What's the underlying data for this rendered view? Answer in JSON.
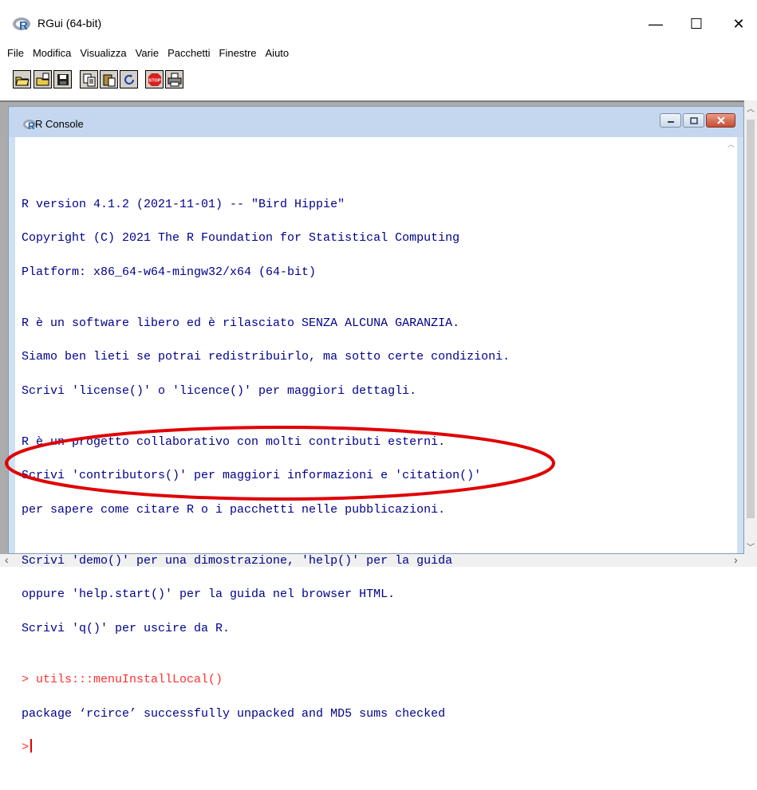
{
  "window": {
    "title": "RGui (64-bit)",
    "app_icon": "R",
    "minimize": "—",
    "maximize": "☐",
    "close": "✕"
  },
  "menu": [
    "File",
    "Modifica",
    "Visualizza",
    "Varie",
    "Pacchetti",
    "Finestre",
    "Aiuto"
  ],
  "toolbar": [
    {
      "icon": "open-folder-icon"
    },
    {
      "icon": "load-workspace-icon"
    },
    {
      "icon": "save-icon"
    },
    {
      "icon": "copy-icon"
    },
    {
      "icon": "paste-icon"
    },
    {
      "icon": "refresh-icon"
    },
    {
      "icon": "stop-icon",
      "label": "STOP"
    },
    {
      "icon": "print-icon"
    }
  ],
  "console": {
    "title": "R Console",
    "icon": "R",
    "lines": [
      {
        "text": "",
        "color": "blue"
      },
      {
        "text": "R version 4.1.2 (2021-11-01) -- \"Bird Hippie\"",
        "color": "blue"
      },
      {
        "text": "Copyright (C) 2021 The R Foundation for Statistical Computing",
        "color": "blue"
      },
      {
        "text": "Platform: x86_64-w64-mingw32/x64 (64-bit)",
        "color": "blue"
      },
      {
        "text": "",
        "color": "blue"
      },
      {
        "text": "R è un software libero ed è rilasciato SENZA ALCUNA GARANZIA.",
        "color": "blue"
      },
      {
        "text": "Siamo ben lieti se potrai redistribuirlo, ma sotto certe condizioni.",
        "color": "blue"
      },
      {
        "text": "Scrivi 'license()' o 'licence()' per maggiori dettagli.",
        "color": "blue"
      },
      {
        "text": "",
        "color": "blue"
      },
      {
        "text": "R è un progetto collaborativo con molti contributi esterni.",
        "color": "blue"
      },
      {
        "text": "Scrivi 'contributors()' per maggiori informazioni e 'citation()'",
        "color": "blue"
      },
      {
        "text": "per sapere come citare R o i pacchetti nelle pubblicazioni.",
        "color": "blue"
      },
      {
        "text": "",
        "color": "blue"
      },
      {
        "text": "Scrivi 'demo()' per una dimostrazione, 'help()' per la guida",
        "color": "blue"
      },
      {
        "text": "oppure 'help.start()' per la guida nel browser HTML.",
        "color": "blue"
      },
      {
        "text": "Scrivi 'q()' per uscire da R.",
        "color": "blue"
      },
      {
        "text": "",
        "color": "blue"
      },
      {
        "text": "> utils:::menuInstallLocal()",
        "color": "red"
      },
      {
        "text": "package ‘rcirce’ successfully unpacked and MD5 sums checked",
        "color": "blue"
      }
    ],
    "prompt": ">"
  },
  "colors": {
    "console_text": "#00008b",
    "input_text": "#ff3030",
    "highlight": "#e00000"
  }
}
